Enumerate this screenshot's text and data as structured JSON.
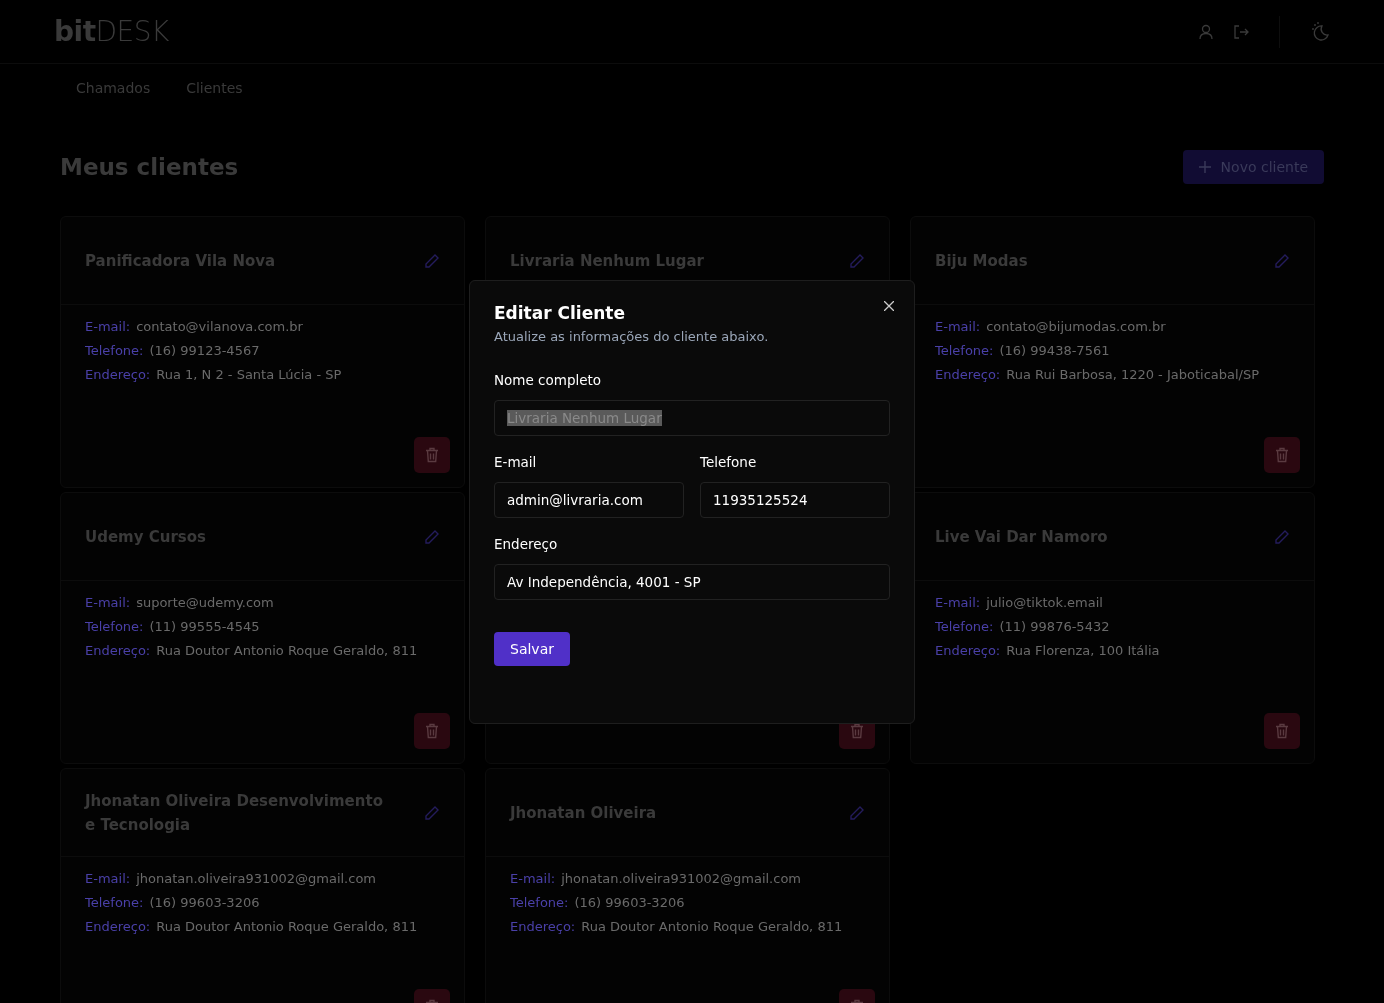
{
  "header": {
    "logo_bold": "bit",
    "logo_light": "DESK"
  },
  "nav": [
    {
      "label": "Chamados"
    },
    {
      "label": "Clientes"
    }
  ],
  "page": {
    "title": "Meus clientes",
    "new_button": "Novo cliente"
  },
  "cards": [
    {
      "kind": "client",
      "name": "Panificadora Vila Nova",
      "fields": [
        {
          "label": "E-mail:",
          "value": "contato@vilanova.com.br"
        },
        {
          "label": "Telefone:",
          "value": "(16) 99123-4567"
        },
        {
          "label": "Endereço:",
          "value": "Rua 1, N 2 - Santa Lúcia - SP"
        }
      ]
    },
    {
      "kind": "client",
      "name": "Livraria Nenhum Lugar"
    },
    {
      "kind": "client",
      "name": "Biju Modas",
      "fields": [
        {
          "label": "E-mail:",
          "value": "contato@bijumodas.com.br"
        },
        {
          "label": "Telefone:",
          "value": "(16) 99438-7561"
        },
        {
          "label": "Endereço:",
          "value": "Rua Rui Barbosa, 1220 - Jaboticabal/SP"
        }
      ]
    },
    {
      "kind": "client",
      "name": "Udemy Cursos",
      "fields": [
        {
          "label": "E-mail:",
          "value": "suporte@udemy.com"
        },
        {
          "label": "Telefone:",
          "value": "(11) 99555-4545"
        },
        {
          "label": "Endereço:",
          "value": "Rua Doutor Antonio Roque Geraldo, 811"
        }
      ]
    },
    {
      "kind": "covered"
    },
    {
      "kind": "client",
      "name": "Live Vai Dar Namoro",
      "fields": [
        {
          "label": "E-mail:",
          "value": "julio@tiktok.email"
        },
        {
          "label": "Telefone:",
          "value": "(11) 99876-5432"
        },
        {
          "label": "Endereço:",
          "value": "Rua Florenza, 100 Itália"
        }
      ]
    },
    {
      "kind": "client",
      "name": "Jhonatan Oliveira Desenvolvimento e Tecnologia",
      "fields": [
        {
          "label": "E-mail:",
          "value": "jhonatan.oliveira931002@gmail.com"
        },
        {
          "label": "Telefone:",
          "value": "(16) 99603-3206"
        },
        {
          "label": "Endereço:",
          "value": "Rua Doutor Antonio Roque Geraldo, 811"
        }
      ]
    },
    {
      "kind": "client",
      "name": "Jhonatan Oliveira",
      "fields": [
        {
          "label": "E-mail:",
          "value": "jhonatan.oliveira931002@gmail.com"
        },
        {
          "label": "Telefone:",
          "value": "(16) 99603-3206"
        },
        {
          "label": "Endereço:",
          "value": "Rua Doutor Antonio Roque Geraldo, 811"
        }
      ]
    }
  ],
  "modal": {
    "title": "Editar Cliente",
    "subtitle": "Atualize as informações do cliente abaixo.",
    "fields": [
      {
        "label": "Nome completo",
        "value": "Livraria Nenhum Lugar",
        "highlighted": true,
        "wide": true
      },
      {
        "label": "E-mail",
        "value": "admin@livraria.com",
        "highlighted": false,
        "wide": false
      },
      {
        "label": "Telefone",
        "value": "11935125524",
        "highlighted": false,
        "wide": false
      },
      {
        "label": "Endereço",
        "value": "Av Independência, 4001 - SP",
        "highlighted": false,
        "wide": true
      }
    ],
    "save_button": "Salvar"
  }
}
